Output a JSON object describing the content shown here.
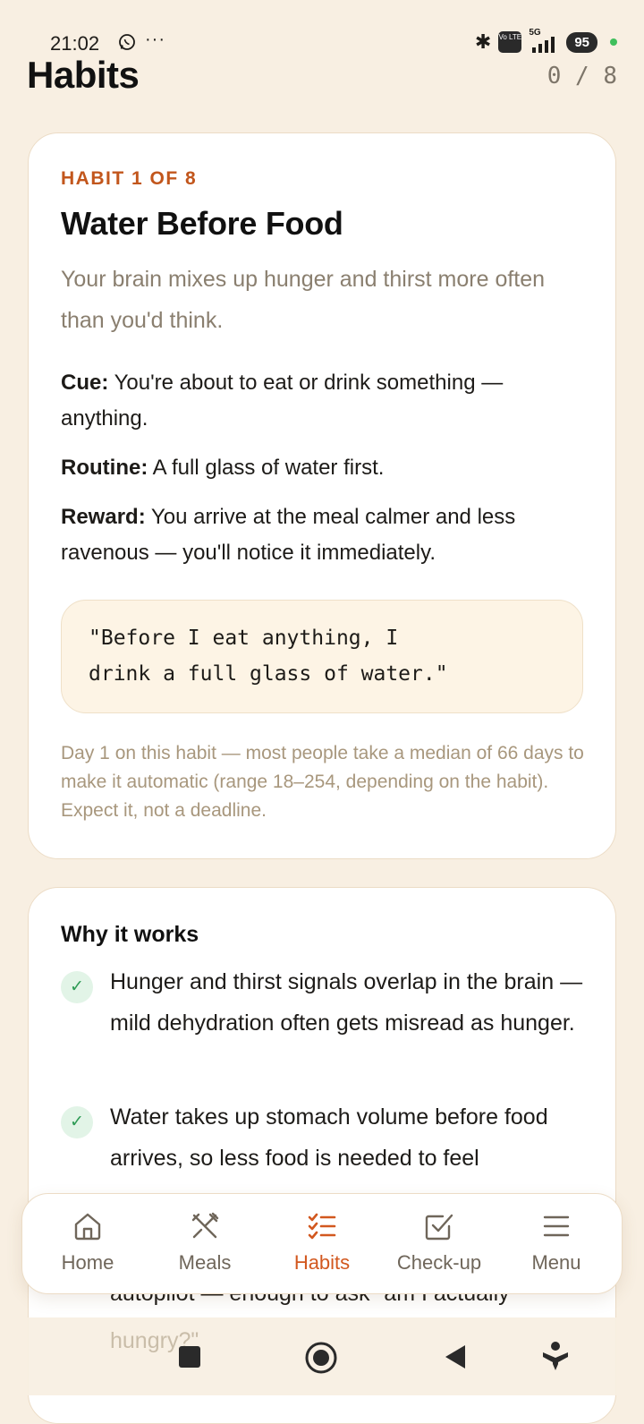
{
  "status_bar": {
    "time": "21:02",
    "more": "···",
    "volte": "Vo LTE",
    "network": "5G",
    "battery": "95"
  },
  "header": {
    "title": "Habits",
    "counter": "0 / 8"
  },
  "habit": {
    "eyebrow": "HABIT 1 OF 8",
    "title": "Water Before Food",
    "subtitle": "Your brain mixes up hunger and thirst more often than you'd think.",
    "cue_label": "Cue:",
    "cue_text": "You're about to eat or drink something — anything.",
    "routine_label": "Routine:",
    "routine_text": "A full glass of water first.",
    "reward_label": "Reward:",
    "reward_text": "You arrive at the meal calmer and less ravenous — you'll notice it immediately.",
    "quote_line1": "\"Before I eat anything, I",
    "quote_line2": "drink a full glass of water.\"",
    "note": "Day 1 on this habit — most people take a median of 66 days to make it automatic (range 18–254, depending on the habit). Expect it, not a deadline."
  },
  "why": {
    "title": "Why it works",
    "items": [
      {
        "text": "Hunger and thirst signals overlap in the brain — mild dehydration often gets misread as hunger."
      },
      {
        "text": "Water takes up stomach volume before food arrives, so less food is needed to feel"
      }
    ],
    "peek_text": "autopilot — enough to ask \"am I actually",
    "peek_text_2": "hungry?\""
  },
  "tabs": [
    {
      "label": "Home",
      "icon": "home-icon"
    },
    {
      "label": "Meals",
      "icon": "utensils-icon"
    },
    {
      "label": "Habits",
      "icon": "checklist-icon",
      "active": true
    },
    {
      "label": "Check-up",
      "icon": "check-square-icon"
    },
    {
      "label": "Menu",
      "icon": "menu-icon"
    }
  ],
  "colors": {
    "accent": "#d2581f",
    "background": "#f8efe2",
    "check_bg": "#e2f4e7",
    "check": "#2e9b55"
  }
}
